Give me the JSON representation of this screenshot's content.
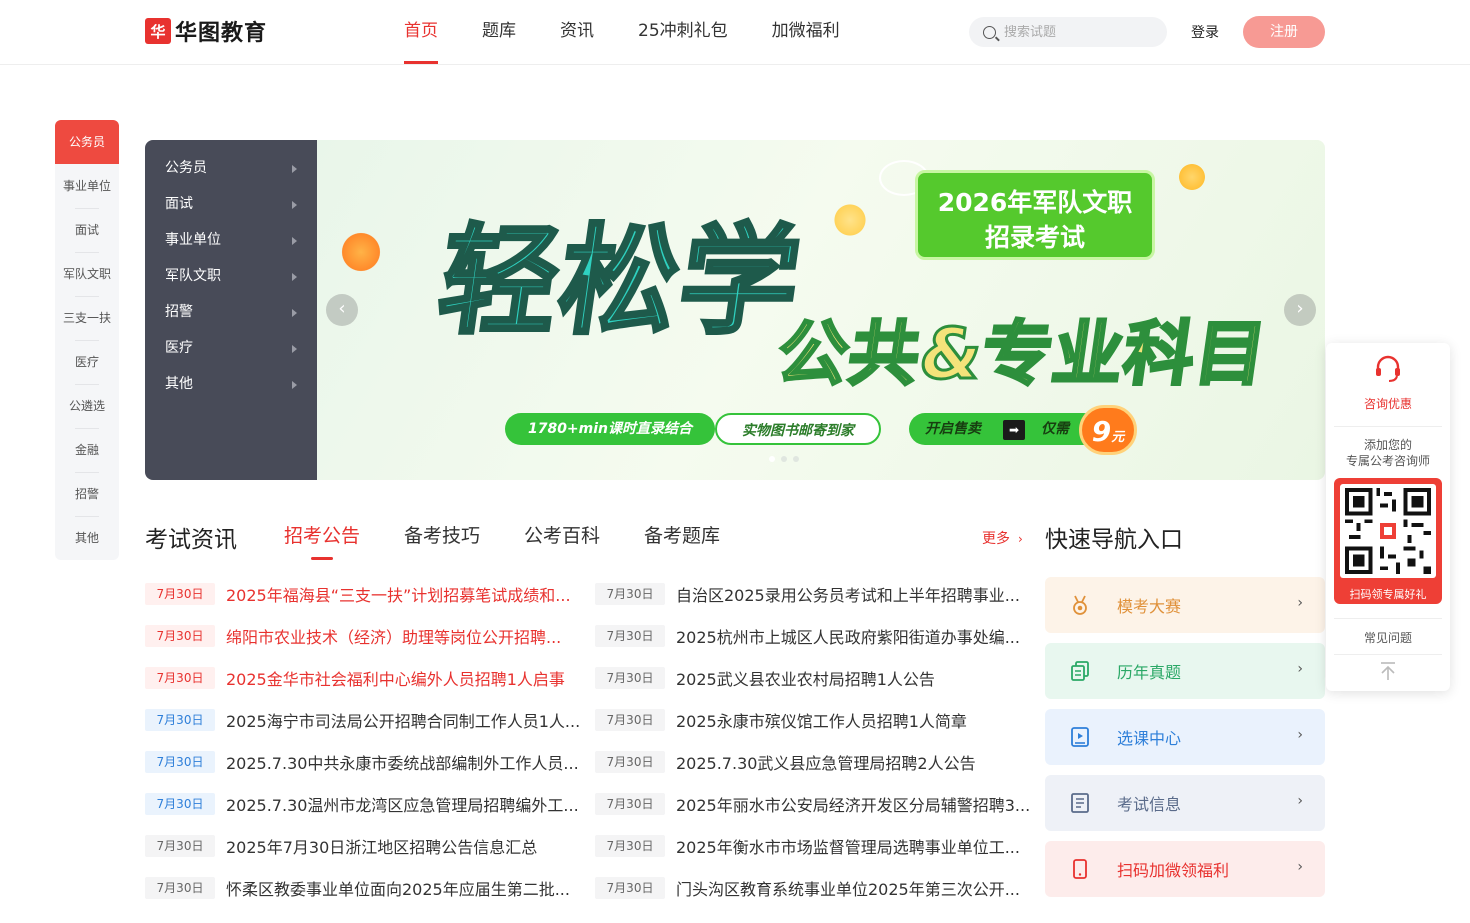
{
  "header": {
    "logo_text": "华图教育",
    "logo_mark": "华",
    "nav": [
      "首页",
      "题库",
      "资讯",
      "25冲刺礼包",
      "加微福利"
    ],
    "search_placeholder": "搜索试题",
    "login": "登录",
    "register": "注册"
  },
  "leftnav": [
    "公务员",
    "事业单位",
    "面试",
    "军队文职",
    "三支一扶",
    "医疗",
    "公遴选",
    "金融",
    "招警",
    "其他"
  ],
  "category_menu": [
    "公务员",
    "面试",
    "事业单位",
    "军队文职",
    "招警",
    "医疗",
    "其他"
  ],
  "banner": {
    "headline": "轻松学",
    "subhead": "公共&专业科目",
    "box_line1": "2026年军队文职",
    "box_line2": "招录考试",
    "pill1": "1780+min课时直录结合",
    "pill2": "实物图书邮寄到家",
    "pill3": "开启售卖",
    "pill3_arrow": "➡",
    "pill3_b": "仅需",
    "price": "9",
    "price_unit": "元",
    "prev": "‹",
    "next": "›"
  },
  "news": {
    "section_title": "考试资讯",
    "tabs": [
      "招考公告",
      "备考技巧",
      "公考百科",
      "备考题库"
    ],
    "more": "更多",
    "more_arrow": "›",
    "left": [
      {
        "date": "7月30日",
        "title": "2025年福海县“三支一扶”计划招募笔试成绩和...",
        "style": "red"
      },
      {
        "date": "7月30日",
        "title": "绵阳市农业技术（经济）助理等岗位公开招聘...",
        "style": "red"
      },
      {
        "date": "7月30日",
        "title": "2025金华市社会福利中心编外人员招聘1人启事",
        "style": "red"
      },
      {
        "date": "7月30日",
        "title": "2025海宁市司法局公开招聘合同制工作人员1人...",
        "style": "blue"
      },
      {
        "date": "7月30日",
        "title": "2025.7.30中共永康市委统战部编制外工作人员...",
        "style": "blue"
      },
      {
        "date": "7月30日",
        "title": "2025.7.30温州市龙湾区应急管理局招聘编外工...",
        "style": "blue"
      },
      {
        "date": "7月30日",
        "title": "2025年7月30日浙江地区招聘公告信息汇总",
        "style": "gray"
      },
      {
        "date": "7月30日",
        "title": "怀柔区教委事业单位面向2025年应届生第二批...",
        "style": "gray"
      }
    ],
    "right": [
      {
        "date": "7月30日",
        "title": "自治区2025录用公务员考试和上半年招聘事业..."
      },
      {
        "date": "7月30日",
        "title": "2025杭州市上城区人民政府紫阳街道办事处编..."
      },
      {
        "date": "7月30日",
        "title": "2025武义县农业农村局招聘1人公告"
      },
      {
        "date": "7月30日",
        "title": "2025永康市殡仪馆工作人员招聘1人简章"
      },
      {
        "date": "7月30日",
        "title": "2025.7.30武义县应急管理局招聘2人公告"
      },
      {
        "date": "7月30日",
        "title": "2025年丽水市公安局经济开发区分局辅警招聘3..."
      },
      {
        "date": "7月30日",
        "title": "2025年衡水市市场监督管理局选聘事业单位工..."
      },
      {
        "date": "7月30日",
        "title": "门头沟区教育系统事业单位2025年第三次公开..."
      }
    ]
  },
  "quick_nav": {
    "title": "快速导航入口",
    "items": [
      {
        "label": "模考大赛",
        "color": "#e0913a",
        "bg": "#fdf3e8",
        "icon": "medal-icon"
      },
      {
        "label": "历年真题",
        "color": "#2aa866",
        "bg": "#e8f7ef",
        "icon": "papers-icon"
      },
      {
        "label": "选课中心",
        "color": "#2e7fd9",
        "bg": "#eaf2fd",
        "icon": "course-icon"
      },
      {
        "label": "考试信息",
        "color": "#5a6b8a",
        "bg": "#eef1f7",
        "icon": "list-icon"
      },
      {
        "label": "扫码加微领福利",
        "color": "#e8322f",
        "bg": "#fdeceb",
        "icon": "phone-icon"
      }
    ],
    "chevron": "›"
  },
  "float_panel": {
    "consult": "咨询优惠",
    "add_line1": "添加您的",
    "add_line2": "专属公考咨询师",
    "qr_label": "扫码领专属好礼",
    "faq": "常见问题"
  },
  "colors": {
    "brand": "#e8322f",
    "menu_bg": "#484b58"
  }
}
